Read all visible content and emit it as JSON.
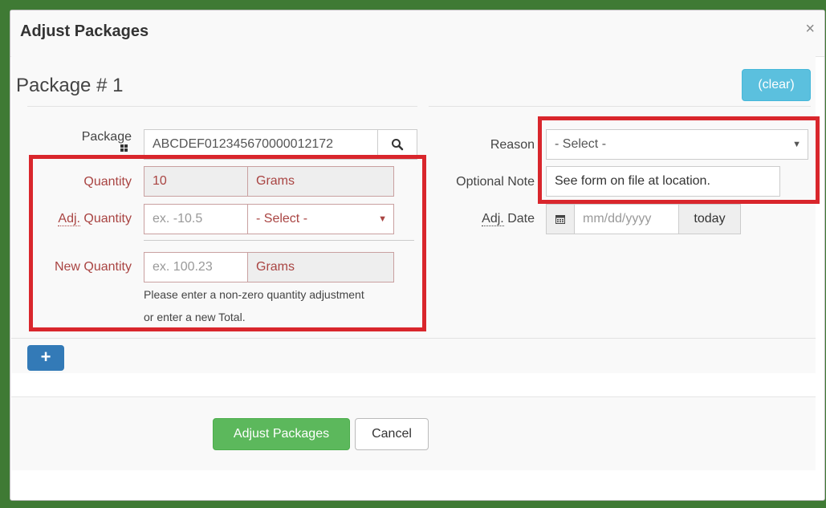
{
  "modal": {
    "title": "Adjust Packages",
    "close_glyph": "×"
  },
  "package": {
    "title": "Package # 1",
    "clear_label": "(clear)",
    "package_label": "Package",
    "package_value": "ABCDEF012345670000012172",
    "search_icon": "search-icon",
    "grid_icon": "grid-icon"
  },
  "quantity": {
    "label": "Quantity",
    "value": "10",
    "unit": "Grams"
  },
  "adj_quantity": {
    "label_abbr": "Adj.",
    "label_rest": " Quantity",
    "placeholder": "ex. -10.5",
    "select_value": "- Select -"
  },
  "new_quantity": {
    "label": "New Quantity",
    "placeholder": "ex. 100.23",
    "unit": "Grams",
    "help_line1": "Please enter a non-zero quantity adjustment",
    "help_line2": "or enter a new Total."
  },
  "reason": {
    "label": "Reason",
    "select_value": "- Select -"
  },
  "note": {
    "label": "Optional Note",
    "value": "See form on file at location."
  },
  "adj_date": {
    "label_abbr": "Adj.",
    "label_rest": " Date",
    "placeholder": "mm/dd/yyyy",
    "today_label": "today",
    "calendar_icon": "calendar-icon"
  },
  "actions": {
    "add_glyph": "+",
    "adjust_label": "Adjust Packages",
    "cancel_label": "Cancel"
  },
  "colors": {
    "highlight": "#d9262c",
    "primary": "#337ab7",
    "success": "#5cb85c",
    "info": "#5bc0de",
    "error_text": "#a94442",
    "frame": "#3f7a34"
  }
}
